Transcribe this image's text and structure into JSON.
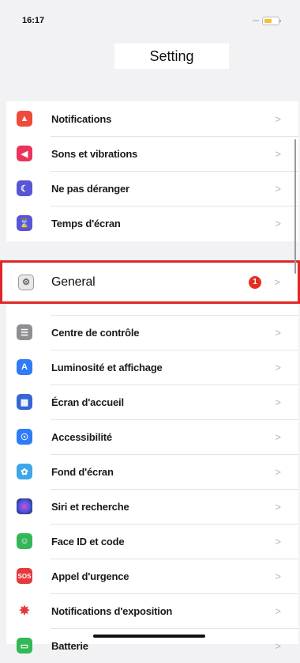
{
  "status": {
    "time": "16:17"
  },
  "header": {
    "title": "Setting"
  },
  "colors": {
    "highlight": "#e02727",
    "badge": "#e43022"
  },
  "group1": [
    {
      "label": "Notifications",
      "icon": "bell-icon",
      "color": "#ef4a3a"
    },
    {
      "label": "Sons et vibrations",
      "icon": "speaker-icon",
      "color": "#e9345b"
    },
    {
      "label": "Ne pas déranger",
      "icon": "moon-icon",
      "color": "#5a55d6"
    },
    {
      "label": "Temps d'écran",
      "icon": "hourglass-icon",
      "color": "#5a55d6"
    }
  ],
  "general": {
    "label": "General",
    "icon": "gear-icon",
    "badge": "1"
  },
  "group2": [
    {
      "label": "Centre de contrôle",
      "icon": "toggles-icon",
      "color": "#8e8e93"
    },
    {
      "label": "Luminosité et affichage",
      "icon": "text-size-icon",
      "color": "#2f7cf6"
    },
    {
      "label": "Écran d'accueil",
      "icon": "grid-icon",
      "color": "#3765d8"
    },
    {
      "label": "Accessibilité",
      "icon": "accessibility-icon",
      "color": "#2f7cf6"
    },
    {
      "label": "Fond d'écran",
      "icon": "flower-icon",
      "color": "#3fa6e8"
    },
    {
      "label": "Siri et recherche",
      "icon": "siri-icon",
      "color": "#333a6e"
    },
    {
      "label": "Face ID et code",
      "icon": "face-id-icon",
      "color": "#34b757"
    },
    {
      "label": "Appel d'urgence",
      "icon": "sos-icon",
      "color": "#e53a3a"
    },
    {
      "label": "Notifications d'exposition",
      "icon": "exposure-icon",
      "color": "#ffffff"
    },
    {
      "label": "Batterie",
      "icon": "battery-icon",
      "color": "#34b757"
    }
  ]
}
